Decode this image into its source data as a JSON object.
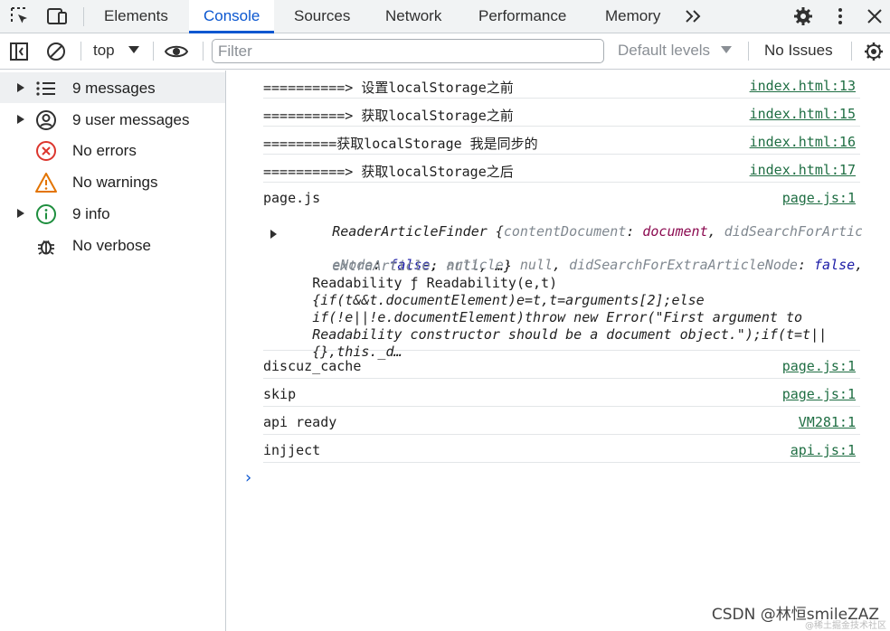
{
  "tabs": [
    "Elements",
    "Console",
    "Sources",
    "Network",
    "Performance",
    "Memory"
  ],
  "active_tab": "Console",
  "toolbar": {
    "context": "top",
    "filter_placeholder": "Filter",
    "levels": "Default levels",
    "issues": "No Issues"
  },
  "sidebar": {
    "items": [
      {
        "label": "9 messages",
        "icon": "list-icon"
      },
      {
        "label": "9 user messages",
        "icon": "user-icon"
      },
      {
        "label": "No errors",
        "icon": "error-icon"
      },
      {
        "label": "No warnings",
        "icon": "warning-icon"
      },
      {
        "label": "9 info",
        "icon": "info-icon"
      },
      {
        "label": "No verbose",
        "icon": "bug-icon"
      }
    ]
  },
  "messages": [
    {
      "text": "==========> 设置localStorage之前",
      "source": "index.html:13"
    },
    {
      "text": "==========> 获取localStorage之前",
      "source": "index.html:15"
    },
    {
      "text": "=========获取localStorage 我是同步的",
      "source": "index.html:16"
    },
    {
      "text": "==========> 获取localStorage之后",
      "source": "index.html:17"
    },
    {
      "text": "page.js",
      "source": "page.js:1"
    },
    {
      "text": "discuz_cache",
      "source": "page.js:1"
    },
    {
      "text": "skip",
      "source": "page.js:1"
    },
    {
      "text": "api ready",
      "source": "VM281:1"
    },
    {
      "text": "injject",
      "source": "api.js:1"
    }
  ],
  "pagejs_detail": {
    "line1_name": "ReaderArticleFinder",
    "line1_open": " {",
    "k_contentDocument": "contentDocument",
    "v_contentDocument": "document",
    "k_didSearch": "didSearchForArticl",
    "k_eNode": "eNode",
    "v_eNode": "false",
    "k_article": "article",
    "v_article": "null",
    "k_didSearchExtra": "didSearchForExtraArticleNode",
    "v_didSearchExtra": "false",
    "k_extraArticle": "extraArticle",
    "v_extraArticle": "null",
    "ellipsis": ", …}",
    "readability_1": "Readability ƒ Readability(e,t)",
    "readability_2": "{if(t&&t.documentElement)e=t,t=arguments[2];else",
    "readability_3": "if(!e||!e.documentElement)throw new Error(\"First argument to",
    "readability_4": "Readability constructor should be a document object.\");if(t=t||",
    "readability_5": "{},this._d…"
  },
  "watermark": "CSDN @林恒smileZAZ",
  "watermark_small": "@稀土掘金技术社区"
}
